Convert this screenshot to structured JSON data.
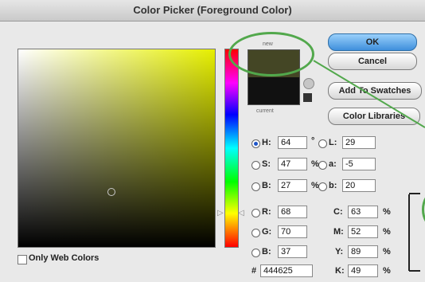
{
  "window": {
    "title": "Color Picker (Foreground Color)"
  },
  "swatch": {
    "new_label": "new",
    "current_label": "current",
    "new_color": "#444625",
    "current_color": "#111111"
  },
  "buttons": {
    "ok": "OK",
    "cancel": "Cancel",
    "add_to_swatches": "Add To Swatches",
    "color_libraries": "Color Libraries"
  },
  "hsb": {
    "h": {
      "label": "H:",
      "value": "64",
      "unit": "°"
    },
    "s": {
      "label": "S:",
      "value": "47",
      "unit": "%"
    },
    "b": {
      "label": "B:",
      "value": "27",
      "unit": "%"
    }
  },
  "rgb": {
    "r": {
      "label": "R:",
      "value": "68"
    },
    "g": {
      "label": "G:",
      "value": "70"
    },
    "b": {
      "label": "B:",
      "value": "37"
    }
  },
  "lab": {
    "l": {
      "label": "L:",
      "value": "29"
    },
    "a": {
      "label": "a:",
      "value": "-5"
    },
    "b": {
      "label": "b:",
      "value": "20"
    }
  },
  "cmyk": {
    "c": {
      "label": "C:",
      "value": "63",
      "unit": "%"
    },
    "m": {
      "label": "M:",
      "value": "52",
      "unit": "%"
    },
    "y": {
      "label": "Y:",
      "value": "89",
      "unit": "%"
    },
    "k": {
      "label": "K:",
      "value": "49",
      "unit": "%"
    }
  },
  "hex": {
    "label": "#",
    "value": "444625"
  },
  "web_colors": {
    "label": "Only Web Colors",
    "checked": false
  },
  "selected_mode": "H",
  "colors": {
    "annotation": "#52a84c",
    "ok_button": "#3f8fdc"
  }
}
